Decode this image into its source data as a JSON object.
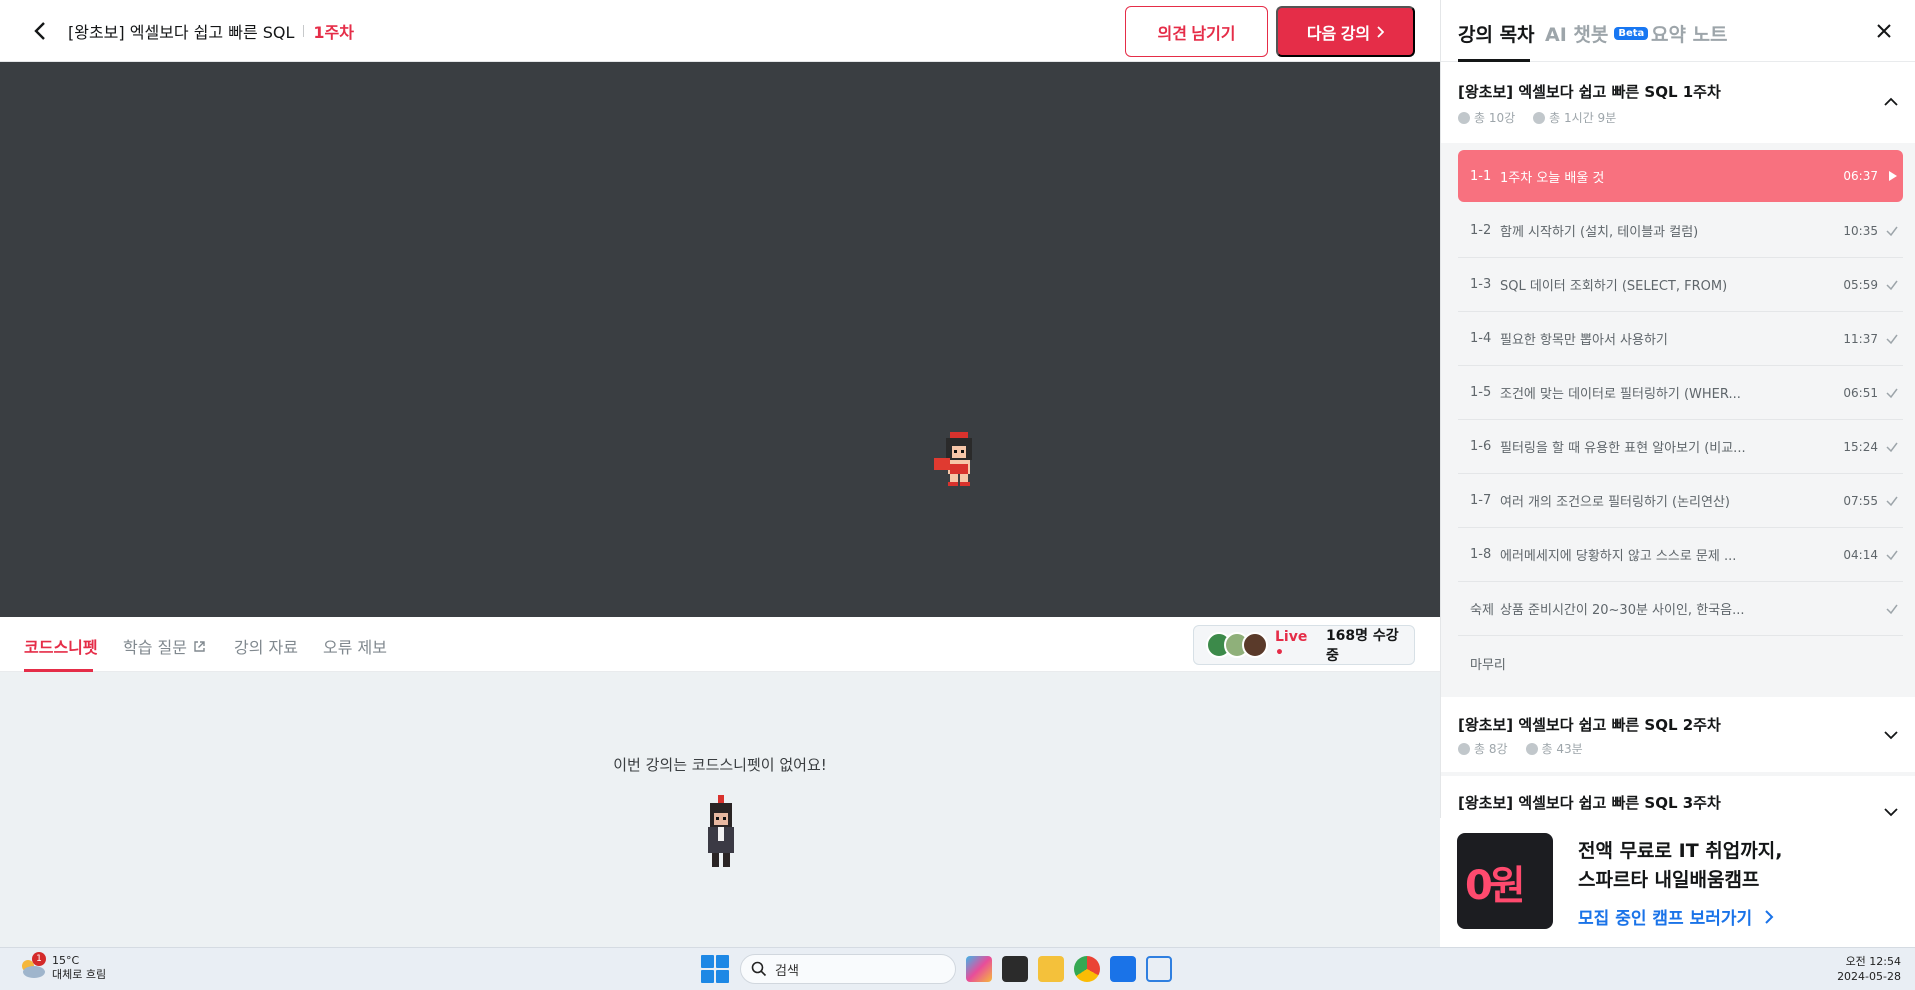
{
  "header": {
    "course_title": "[왕초보] 엑셀보다 쉽고 빠른 SQL",
    "week_label": "1주차",
    "feedback_button": "의견 남기기",
    "next_button": "다음 강의"
  },
  "lower_tabs": {
    "items": [
      "코드스니펫",
      "학습 질문",
      "강의 자료",
      "오류 제보"
    ],
    "live_label": "Live •",
    "live_count": "168명 수강 중"
  },
  "snippet": {
    "empty_message": "이번 강의는 코드스니펫이 없어요!"
  },
  "panel": {
    "tabs": [
      "강의 목차",
      "AI 챗봇",
      "요약 노트"
    ],
    "beta_badge": "Beta",
    "weeks": [
      {
        "title": "[왕초보] 엑셀보다 쉽고 빠른 SQL 1주차",
        "lesson_count": "총 10강",
        "duration": "총 1시간 9분"
      },
      {
        "title": "[왕초보] 엑셀보다 쉽고 빠른 SQL 2주차",
        "lesson_count": "총 8강",
        "duration": "총 43분"
      },
      {
        "title": "[왕초보] 엑셀보다 쉽고 빠른 SQL 3주차"
      }
    ],
    "lessons": [
      {
        "num": "1-1",
        "title": "1주차 오늘 배울 것",
        "time": "06:37"
      },
      {
        "num": "1-2",
        "title": "함께 시작하기 (설치, 테이블과 컬럼)",
        "time": "10:35"
      },
      {
        "num": "1-3",
        "title": "SQL 데이터 조회하기 (SELECT, FROM)",
        "time": "05:59"
      },
      {
        "num": "1-4",
        "title": "필요한 항목만 뽑아서 사용하기",
        "time": "11:37"
      },
      {
        "num": "1-5",
        "title": "조건에 맞는 데이터로 필터링하기 (WHER...",
        "time": "06:51"
      },
      {
        "num": "1-6",
        "title": "필터링을 할 때 유용한 표현 알아보기 (비교...",
        "time": "15:24"
      },
      {
        "num": "1-7",
        "title": "여러 개의 조건으로 필터링하기 (논리연산)",
        "time": "07:55"
      },
      {
        "num": "1-8",
        "title": "에러메세지에 당황하지 않고 스스로 문제 ...",
        "time": "04:14"
      },
      {
        "num": "숙제",
        "title": "상품 준비시간이 20~30분 사이인, 한국음...",
        "time": ""
      },
      {
        "num": "",
        "title": "마무리",
        "time": ""
      }
    ],
    "ad": {
      "image_text": "0원",
      "line1": "전액 무료로 IT 취업까지,",
      "line2": "스파르타 내일배움캠프",
      "link": "모집 중인 캠프 보러가기"
    }
  },
  "taskbar": {
    "weather_badge": "1",
    "temperature": "15°C",
    "weather": "대체로 흐림",
    "search_placeholder": "검색",
    "time": "오전 12:54",
    "date": "2024-05-28"
  },
  "colors": {
    "accent": "#e52d48",
    "active_lesson": "#f8717f",
    "video_bg": "#3a3e42",
    "link": "#1a73e8"
  }
}
